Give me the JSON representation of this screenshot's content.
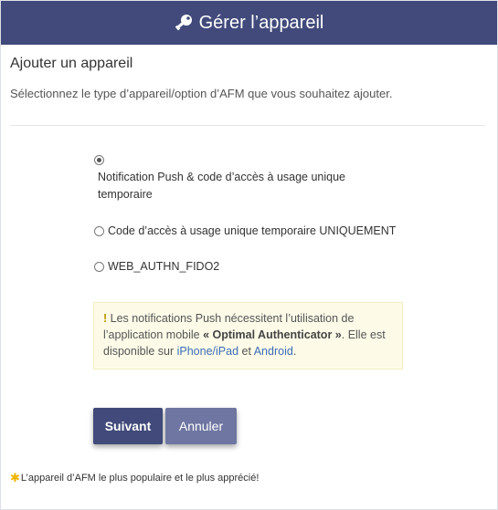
{
  "header": {
    "title": "Gérer l’appareil",
    "icon": "key-icon"
  },
  "section": {
    "title": "Ajouter un appareil",
    "intro": "Sélectionnez le type d’appareil/option d’AFM que vous souhaitez ajouter."
  },
  "options": [
    {
      "line1": "Notification Push & code d’accès à usage unique",
      "line2": "temporaire",
      "checked": true
    },
    {
      "label": "Code d’accès à usage unique temporaire UNIQUEMENT",
      "checked": false
    },
    {
      "label": "WEB_AUTHN_FIDO2",
      "checked": false
    }
  ],
  "alert": {
    "icon": "!",
    "text1": " Les notifications Push nécessitent l’utilisation de l’application mobile ",
    "strong": "« Optimal Authenticator »",
    "text2": ". Elle est disponible sur ",
    "link1": "iPhone/iPad",
    "text3": " et ",
    "link2": "Android",
    "text4": "."
  },
  "buttons": {
    "next": "Suivant",
    "cancel": "Annuler"
  },
  "footnote": {
    "star": "✱",
    "text": "L’appareil d’AFM le plus populaire et le plus apprécié!"
  },
  "colors": {
    "header_bg": "#414a7a",
    "primary": "#414a7a",
    "secondary": "#6e76a1",
    "alert_bg": "#fdfbe8",
    "star": "#f0b400"
  }
}
